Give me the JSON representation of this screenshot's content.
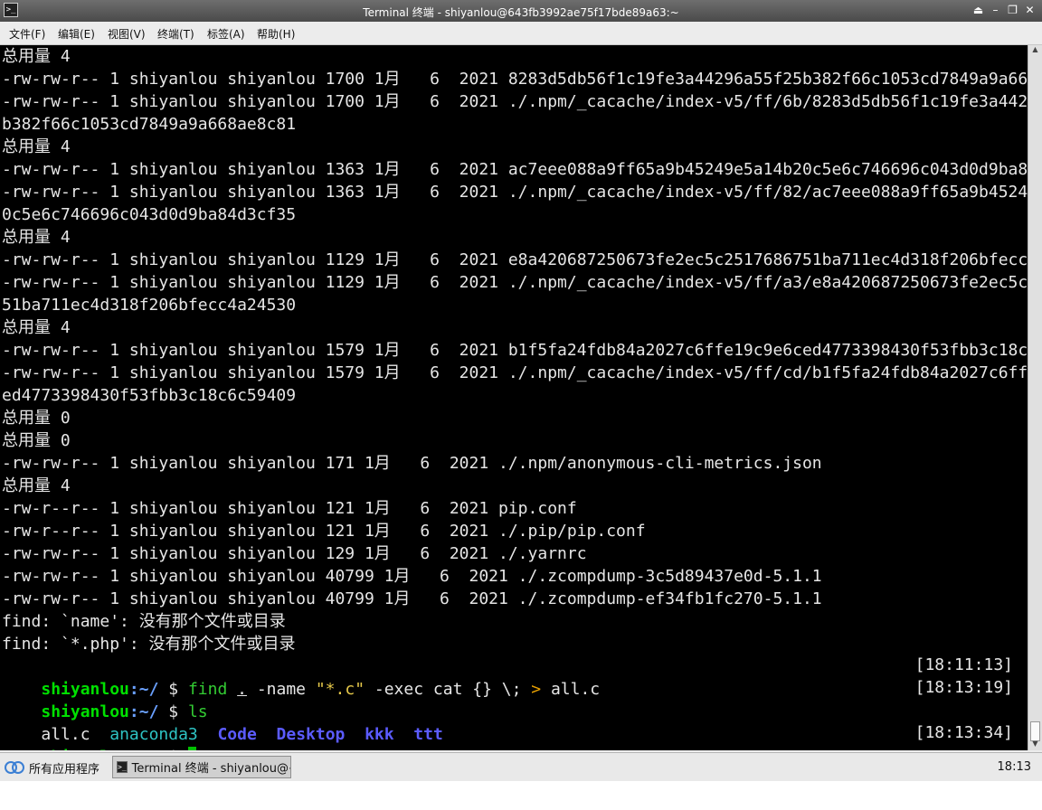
{
  "window": {
    "title": "Terminal 终端 - shiyanlou@643fb3992ae75f17bde89a63:~",
    "controls": [
      "⏏",
      "–",
      "❐",
      "✕"
    ]
  },
  "menu": [
    "文件(F)",
    "编辑(E)",
    "视图(V)",
    "终端(T)",
    "标签(A)",
    "帮助(H)"
  ],
  "terminal": {
    "output": [
      "总用量 4",
      "-rw-rw-r-- 1 shiyanlou shiyanlou 1700 1月   6  2021 8283d5db56f1c19fe3a44296a55f25b382f66c1053cd7849a9a668ae8c81",
      "-rw-rw-r-- 1 shiyanlou shiyanlou 1700 1月   6  2021 ./.npm/_cacache/index-v5/ff/6b/8283d5db56f1c19fe3a44296a55f25",
      "b382f66c1053cd7849a9a668ae8c81",
      "总用量 4",
      "-rw-rw-r-- 1 shiyanlou shiyanlou 1363 1月   6  2021 ac7eee088a9ff65a9b45249e5a14b20c5e6c746696c043d0d9ba84d3cf35",
      "-rw-rw-r-- 1 shiyanlou shiyanlou 1363 1月   6  2021 ./.npm/_cacache/index-v5/ff/82/ac7eee088a9ff65a9b45249e5a14b2",
      "0c5e6c746696c043d0d9ba84d3cf35",
      "总用量 4",
      "-rw-rw-r-- 1 shiyanlou shiyanlou 1129 1月   6  2021 e8a420687250673fe2ec5c2517686751ba711ec4d318f206bfecc4a24530",
      "-rw-rw-r-- 1 shiyanlou shiyanlou 1129 1月   6  2021 ./.npm/_cacache/index-v5/ff/a3/e8a420687250673fe2ec5c25176867",
      "51ba711ec4d318f206bfecc4a24530",
      "总用量 4",
      "-rw-rw-r-- 1 shiyanlou shiyanlou 1579 1月   6  2021 b1f5fa24fdb84a2027c6ffe19c9e6ced4773398430f53fbb3c18c6c59409",
      "-rw-rw-r-- 1 shiyanlou shiyanlou 1579 1月   6  2021 ./.npm/_cacache/index-v5/ff/cd/b1f5fa24fdb84a2027c6ffe19c9e6c",
      "ed4773398430f53fbb3c18c6c59409",
      "总用量 0",
      "总用量 0",
      "-rw-rw-r-- 1 shiyanlou shiyanlou 171 1月   6  2021 ./.npm/anonymous-cli-metrics.json",
      "总用量 4",
      "-rw-r--r-- 1 shiyanlou shiyanlou 121 1月   6  2021 pip.conf",
      "-rw-r--r-- 1 shiyanlou shiyanlou 121 1月   6  2021 ./.pip/pip.conf",
      "-rw-rw-r-- 1 shiyanlou shiyanlou 129 1月   6  2021 ./.yarnrc",
      "-rw-rw-r-- 1 shiyanlou shiyanlou 40799 1月   6  2021 ./.zcompdump-3c5d89437e0d-5.1.1",
      "-rw-rw-r-- 1 shiyanlou shiyanlou 40799 1月   6  2021 ./.zcompdump-ef34fb1fc270-5.1.1",
      "find: `name': 没有那个文件或目录",
      "find: `*.php': 没有那个文件或目录"
    ],
    "prompt": {
      "user": "shiyanlou",
      "path": ":~/",
      "symbol": " $ "
    },
    "cmd1": {
      "find": "find",
      "dot": ".",
      "name_flag": " -name ",
      "pattern": "\"*.c\"",
      "exec": " -exec cat {} \\; ",
      "redirect": ">",
      "target": " all.c",
      "time": "[18:11:13]"
    },
    "cmd2": {
      "ls": "ls",
      "time": "[18:13:19]"
    },
    "ls_output": {
      "file": "all.c",
      "conda": "anaconda3",
      "dirs": [
        "Code",
        "Desktop",
        "kkk",
        "ttt"
      ]
    },
    "cmd3": {
      "time": "[18:13:34]"
    }
  },
  "taskbar": {
    "start_label": "所有应用程序",
    "task_label": "Terminal 终端 - shiyanlou@⋯",
    "clock": "18:13"
  }
}
